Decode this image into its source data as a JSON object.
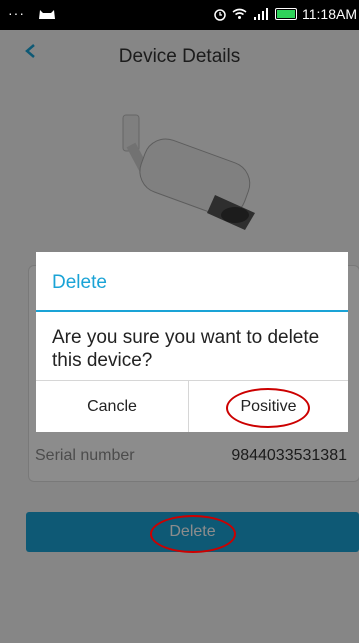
{
  "status_bar": {
    "left_dots": "···",
    "time": "11:18AM",
    "battery_color": "#2fd35a"
  },
  "header": {
    "title": "Device Details",
    "back_icon": "chevron-left-icon"
  },
  "device": {
    "image_icon": "security-camera-icon",
    "serial_label": "Serial number",
    "serial_value": "9844033531381"
  },
  "actions": {
    "delete_label": "Delete",
    "accent_color": "#1aa3d6"
  },
  "dialog": {
    "title": "Delete",
    "message": "Are you sure you want to delete this device?",
    "cancel_label": "Cancle",
    "positive_label": "Positive"
  },
  "annotations": {
    "highlight_color": "#cc0000"
  }
}
